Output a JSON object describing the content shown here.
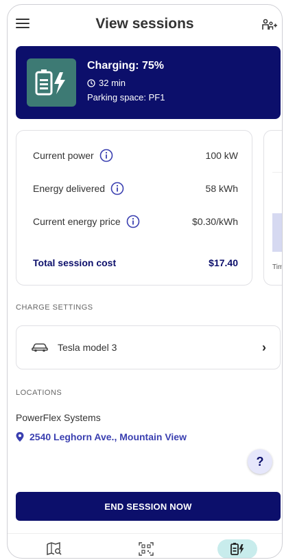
{
  "header": {
    "title": "View sessions",
    "menu_icon": "hamburger-icon",
    "right_icon": "family-icon"
  },
  "status": {
    "title": "Charging: 75%",
    "duration": "32 min",
    "parking": "Parking space: PF1",
    "icon": "battery-charging-icon"
  },
  "metrics": {
    "rows": [
      {
        "label": "Current power",
        "value": "100 kW"
      },
      {
        "label": "Energy delivered",
        "value": "58 kWh"
      },
      {
        "label": "Current energy price",
        "value": "$0.30/kWh"
      }
    ],
    "total_label": "Total session cost",
    "total_value": "$17.40"
  },
  "peek_card": {
    "label": "Tim"
  },
  "charge_settings": {
    "section_label": "CHARGE SETTINGS",
    "vehicle": "Tesla model 3",
    "chevron": "›"
  },
  "locations": {
    "section_label": "LOCATIONS",
    "name": "PowerFlex Systems",
    "address": "2540 Leghorn Ave., Mountain View"
  },
  "help": {
    "label": "?"
  },
  "end_session": {
    "label": "END SESSION NOW"
  },
  "nav": {
    "items": [
      {
        "icon": "map-search-icon"
      },
      {
        "icon": "qr-scan-icon"
      },
      {
        "icon": "charging-station-icon",
        "active": true
      }
    ]
  },
  "colors": {
    "primary": "#0c0f6b",
    "tile": "#3d7a74",
    "link": "#3a3fb0",
    "active_nav": "#c8ecec"
  }
}
